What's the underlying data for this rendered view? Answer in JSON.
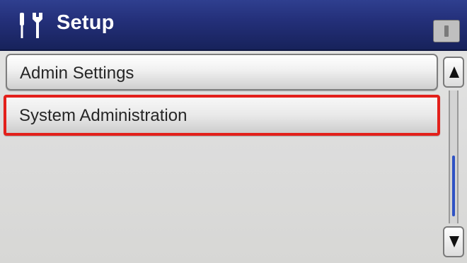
{
  "header": {
    "title": "Setup",
    "icon": "tools-icon",
    "status_icon": "info-status-icon"
  },
  "menu": {
    "items": [
      {
        "label": "Admin Settings",
        "selected": false
      },
      {
        "label": "System Administration",
        "selected": true
      }
    ]
  },
  "scrollbar": {
    "up_icon": "up-arrow-icon",
    "down_icon": "down-arrow-icon",
    "position": "bottom"
  },
  "colors": {
    "header_blue": "#24307a",
    "highlight_red": "#e3201b",
    "scroll_thumb_blue": "#2f52c4"
  }
}
